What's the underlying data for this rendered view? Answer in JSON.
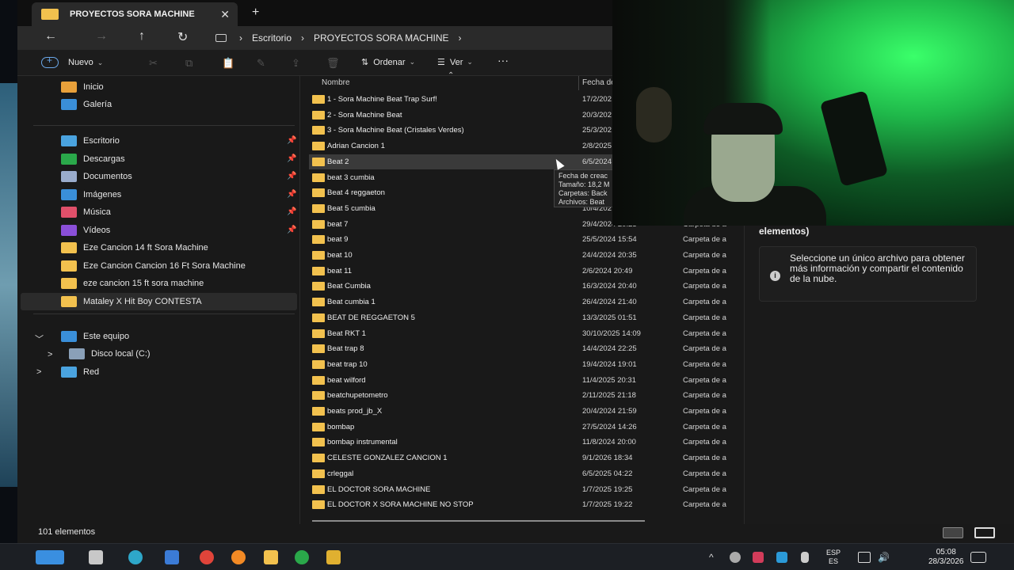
{
  "window": {
    "tab_title": "PROYECTOS SORA MACHINE",
    "tab_close": "✕",
    "new_tab": "+"
  },
  "address": {
    "back": "←",
    "forward": "→",
    "up": "↑",
    "refresh": "↻",
    "crumbs": [
      "Escritorio",
      "PROYECTOS SORA MACHINE"
    ],
    "sep": "›"
  },
  "toolbar": {
    "new_label": "Nuevo",
    "sort_label": "Ordenar",
    "view_label": "Ver",
    "more": "···",
    "sort_icon": "⇅",
    "view_icon": "☰"
  },
  "sidebar": {
    "top": [
      {
        "label": "Inicio",
        "icon": "home-icon",
        "color": "#e8a03a"
      },
      {
        "label": "Galería",
        "icon": "gallery-icon",
        "color": "#3a8fd9"
      }
    ],
    "pinned": [
      {
        "label": "Escritorio",
        "icon": "desktop-icon",
        "color": "#4aa3df"
      },
      {
        "label": "Descargas",
        "icon": "downloads-icon",
        "color": "#2aa84a"
      },
      {
        "label": "Documentos",
        "icon": "documents-icon",
        "color": "#9aaccc"
      },
      {
        "label": "Imágenes",
        "icon": "pictures-icon",
        "color": "#3a8fd9"
      },
      {
        "label": "Música",
        "icon": "music-icon",
        "color": "#e0506a"
      },
      {
        "label": "Vídeos",
        "icon": "videos-icon",
        "color": "#8a4fd8"
      }
    ],
    "folders": [
      "Eze Cancion 14 ft Sora Machine",
      "Eze Cancion Cancion 16 Ft Sora Machine",
      "eze cancion 15 ft sora machine",
      "Mataley X Hit Boy CONTESTA"
    ],
    "this_pc": "Este equipo",
    "local_disk": "Disco local (C:)",
    "network": "Red",
    "pin_glyph": "📌",
    "expand_open": "﹀",
    "expand_closed": ">"
  },
  "list": {
    "col_name": "Nombre",
    "col_date": "Fecha de",
    "rows": [
      {
        "name": "1 - Sora Machine Beat Trap Surf!",
        "date": "17/2/202",
        "type": ""
      },
      {
        "name": "2 - Sora Machine Beat",
        "date": "20/3/202",
        "type": ""
      },
      {
        "name": "3 - Sora Machine Beat (Cristales Verdes)",
        "date": "25/3/202",
        "type": ""
      },
      {
        "name": "Adrian Cancion 1",
        "date": "2/8/2025",
        "type": ""
      },
      {
        "name": "Beat 2",
        "date": "6/5/2024",
        "type": ""
      },
      {
        "name": "beat 3 cumbia",
        "date": "",
        "type": ""
      },
      {
        "name": "Beat 4 reggaeton",
        "date": "",
        "type": ""
      },
      {
        "name": "Beat 5 cumbia",
        "date": "10/4/202",
        "type": ""
      },
      {
        "name": "beat 7",
        "date": "29/4/2024 20:23",
        "type": "Carpeta de a"
      },
      {
        "name": "beat 9",
        "date": "25/5/2024 15:54",
        "type": "Carpeta de a"
      },
      {
        "name": "beat 10",
        "date": "24/4/2024 20:35",
        "type": "Carpeta de a"
      },
      {
        "name": "beat 11",
        "date": "2/6/2024 20:49",
        "type": "Carpeta de a"
      },
      {
        "name": "Beat Cumbia",
        "date": "16/3/2024 20:40",
        "type": "Carpeta de a"
      },
      {
        "name": "Beat cumbia 1",
        "date": "26/4/2024 21:40",
        "type": "Carpeta de a"
      },
      {
        "name": "BEAT DE REGGAETON 5",
        "date": "13/3/2025 01:51",
        "type": "Carpeta de a"
      },
      {
        "name": "Beat RKT 1",
        "date": "30/10/2025 14:09",
        "type": "Carpeta de a"
      },
      {
        "name": "Beat trap 8",
        "date": "14/4/2024 22:25",
        "type": "Carpeta de a"
      },
      {
        "name": "beat trap 10",
        "date": "19/4/2024 19:01",
        "type": "Carpeta de a"
      },
      {
        "name": "beat wilford",
        "date": "11/4/2025 20:31",
        "type": "Carpeta de a"
      },
      {
        "name": "beatchupetometro",
        "date": "2/11/2025 21:18",
        "type": "Carpeta de a"
      },
      {
        "name": "beats prod_jb_X",
        "date": "20/4/2024 21:59",
        "type": "Carpeta de a"
      },
      {
        "name": "bombap",
        "date": "27/5/2024 14:26",
        "type": "Carpeta de a"
      },
      {
        "name": "bombap instrumental",
        "date": "11/8/2024 20:00",
        "type": "Carpeta de a"
      },
      {
        "name": "CELESTE GONZALEZ CANCION 1",
        "date": "9/1/2026 18:34",
        "type": "Carpeta de a"
      },
      {
        "name": "crleggal",
        "date": "6/5/2025 04:22",
        "type": "Carpeta de a"
      },
      {
        "name": "EL DOCTOR SORA MACHINE",
        "date": "1/7/2025 19:25",
        "type": "Carpeta de a"
      },
      {
        "name": "EL DOCTOR X SORA MACHINE NO STOP",
        "date": "1/7/2025 19:22",
        "type": "Carpeta de a"
      }
    ],
    "tooltip": [
      "Fecha de creac",
      "Tamaño: 18,2 M",
      "Carpetas: Back",
      "Archivos: Beat"
    ]
  },
  "details": {
    "header": "elementos)",
    "info_icon": "i",
    "info_text": "Seleccione un único archivo para obtener más información y compartir el contenido de la nube."
  },
  "status": {
    "count": "101 elementos"
  },
  "taskbar": {
    "lang_top": "ESP",
    "lang_bottom": "ES",
    "time": "05:08",
    "date": "28/3/2026",
    "chevron": "^"
  }
}
